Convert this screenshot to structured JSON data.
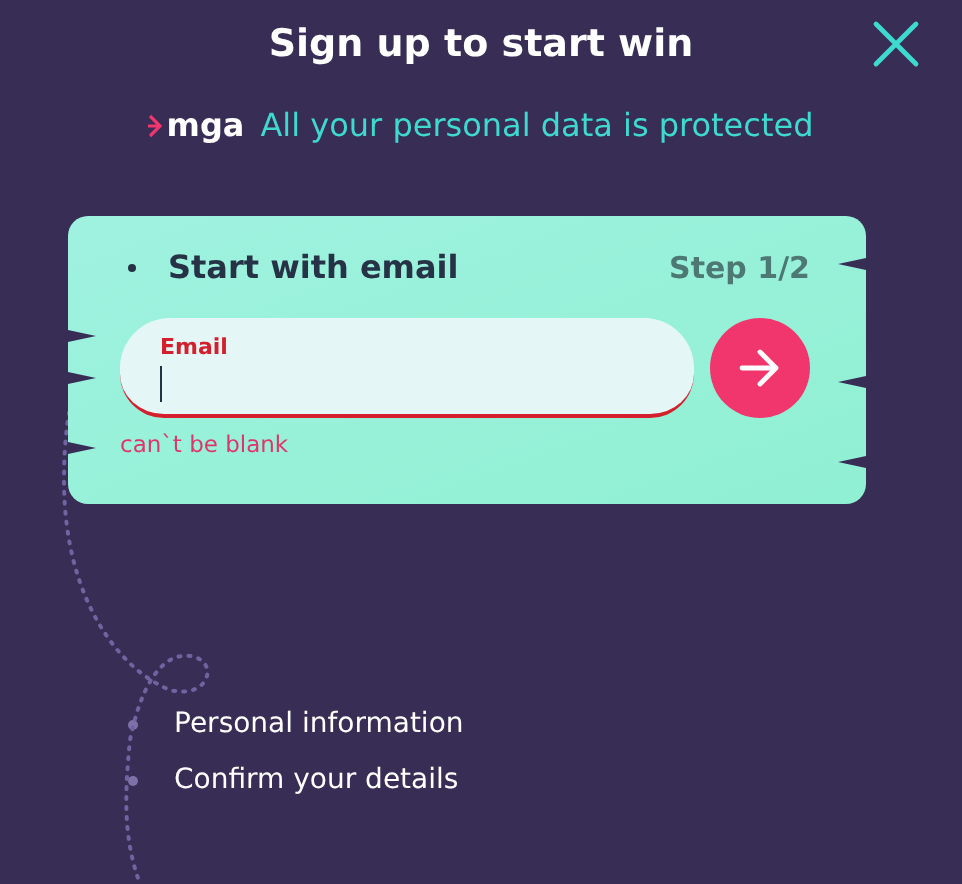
{
  "header": {
    "title": "Sign up to start win",
    "logo": "mga",
    "subtitle": "All your personal data is protected"
  },
  "card": {
    "title": "Start with email",
    "step": "Step 1/2",
    "field": {
      "label": "Email",
      "error": "can`t be blank"
    }
  },
  "steps": [
    {
      "label": "Personal information"
    },
    {
      "label": "Confirm your details"
    }
  ]
}
